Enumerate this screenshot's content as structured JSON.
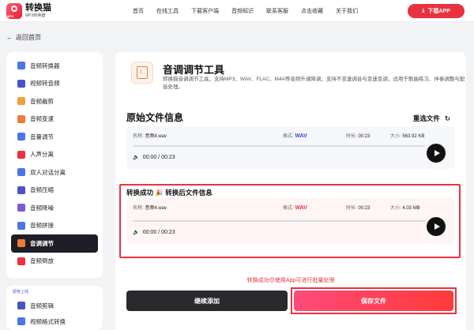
{
  "app": {
    "title": "转换猫",
    "subtitle": "MP3转换器",
    "badge": "MP3",
    "download_label": "下载APP"
  },
  "nav": {
    "items": [
      "首页",
      "在线工具",
      "下载客户端",
      "音频知识",
      "联系客服",
      "点击收藏",
      "关于我们"
    ]
  },
  "back_label": "返回首页",
  "sidebar": {
    "items": [
      {
        "label": "音频转换器",
        "color": "#4a76e8"
      },
      {
        "label": "视频转音频",
        "color": "#4a52c9"
      },
      {
        "label": "音频裁剪",
        "color": "#f0a23a"
      },
      {
        "label": "音频变速",
        "color": "#f07a3a"
      },
      {
        "label": "音量调节",
        "color": "#4a76e8"
      },
      {
        "label": "人声分离",
        "color": "#e8323f"
      },
      {
        "label": "双人对话分离",
        "color": "#4a76e8"
      },
      {
        "label": "音频压缩",
        "color": "#4a52c9"
      },
      {
        "label": "音频降噪",
        "color": "#7a5ad6"
      },
      {
        "label": "音频拼接",
        "color": "#4a76e8"
      },
      {
        "label": "音调调节",
        "color": "#f07a3a"
      },
      {
        "label": "音频倒放",
        "color": "#e8323f"
      }
    ],
    "active_index": 10,
    "section_label": "即将上线",
    "upcoming": [
      {
        "label": "音频剪辑",
        "color": "#4a52c9"
      },
      {
        "label": "视频格式转换",
        "color": "#4a76e8"
      }
    ]
  },
  "tool": {
    "title": "音调调节工具",
    "description": "转换猫音调调节工具，支持MP3、WAV、FLAC、M4A等音频升调降调，支持不变速调音与变速变调，适用于歌曲练习、伴奏调整与配音处理。"
  },
  "original": {
    "section_title": "原始文件信息",
    "reselect_label": "重选文件",
    "name_label": "名称:",
    "name": "音频4.wav",
    "format_label": "格式:",
    "format": "WAV",
    "duration_label": "时长:",
    "duration": "00:23",
    "size_label": "大小:",
    "size": "563.92 KB",
    "time": "00:00 / 00:23",
    "progress": 0
  },
  "converted": {
    "section_title": "转换成功 🎉 转换后文件信息",
    "name_label": "名称:",
    "name": "音频4.wav",
    "format_label": "格式:",
    "format": "WAV",
    "duration_label": "时长:",
    "duration": "00:23",
    "size_label": "大小:",
    "size": "4.03 MB",
    "time": "00:00 / 00:23",
    "progress": 0
  },
  "hint": "转换成功😊使用App可进行批量处理",
  "actions": {
    "continue_label": "继续添加",
    "save_label": "保存文件"
  }
}
